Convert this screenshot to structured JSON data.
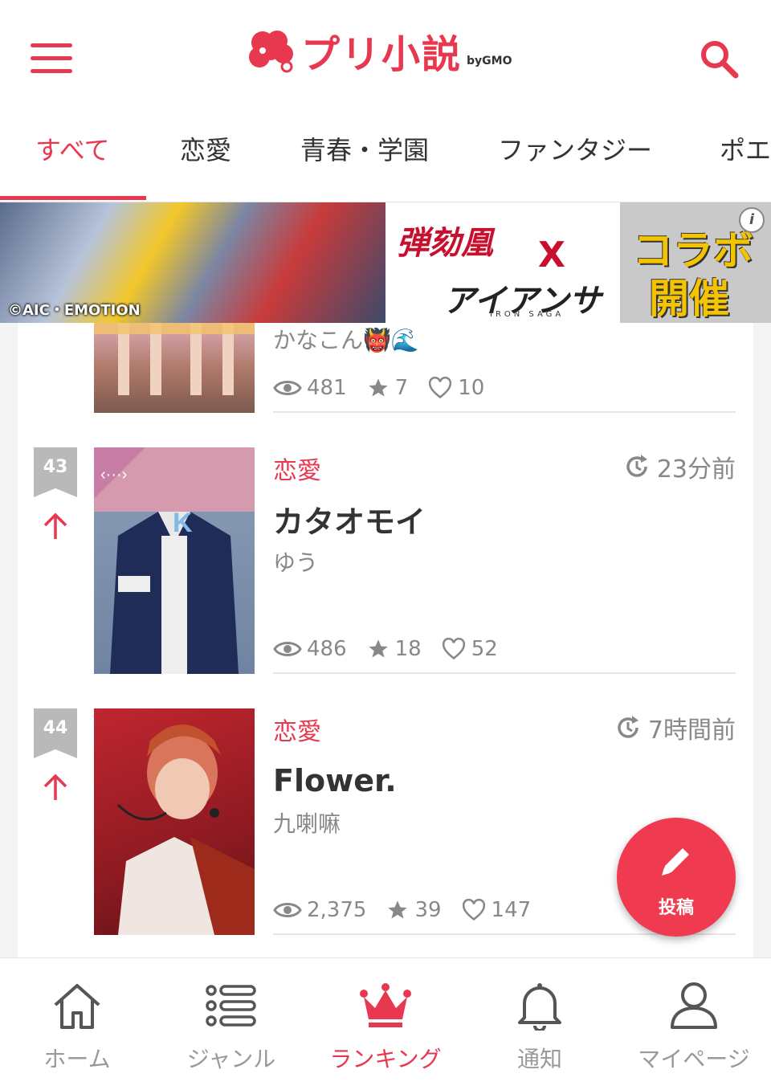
{
  "header": {
    "logo_text": "プリ小説",
    "logo_by": "byGMO"
  },
  "tabs": [
    {
      "label": "すべて",
      "active": true
    },
    {
      "label": "恋愛",
      "active": false
    },
    {
      "label": "青春・学園",
      "active": false
    },
    {
      "label": "ファンタジー",
      "active": false
    },
    {
      "label": "ポエ",
      "active": false
    }
  ],
  "ad": {
    "copyright": "©AIC・EMOTION",
    "title1": "弾劾凰",
    "x": "X",
    "title2": "アイアンサーガ",
    "subtitle": "IRON SAGA",
    "collab1": "コラボ",
    "collab2": "開催",
    "info": "i"
  },
  "items": [
    {
      "author": "かなこん👹🌊",
      "views": "481",
      "stars": "7",
      "likes": "10"
    },
    {
      "rank": "43",
      "genre": "恋愛",
      "time": "23分前",
      "title": "カタオモイ",
      "author": "ゆう",
      "views": "486",
      "stars": "18",
      "likes": "52"
    },
    {
      "rank": "44",
      "genre": "恋愛",
      "time": "7時間前",
      "title": "Flower.",
      "author": "九喇嘛",
      "views": "2,375",
      "stars": "39",
      "likes": "147"
    }
  ],
  "fab": {
    "label": "投稿"
  },
  "bottom_nav": [
    {
      "label": "ホーム",
      "icon": "home-icon"
    },
    {
      "label": "ジャンル",
      "icon": "list-icon"
    },
    {
      "label": "ランキング",
      "icon": "crown-icon",
      "active": true
    },
    {
      "label": "通知",
      "icon": "bell-icon"
    },
    {
      "label": "マイページ",
      "icon": "person-icon"
    }
  ],
  "colors": {
    "accent": "#e8384f",
    "muted": "#888888"
  }
}
